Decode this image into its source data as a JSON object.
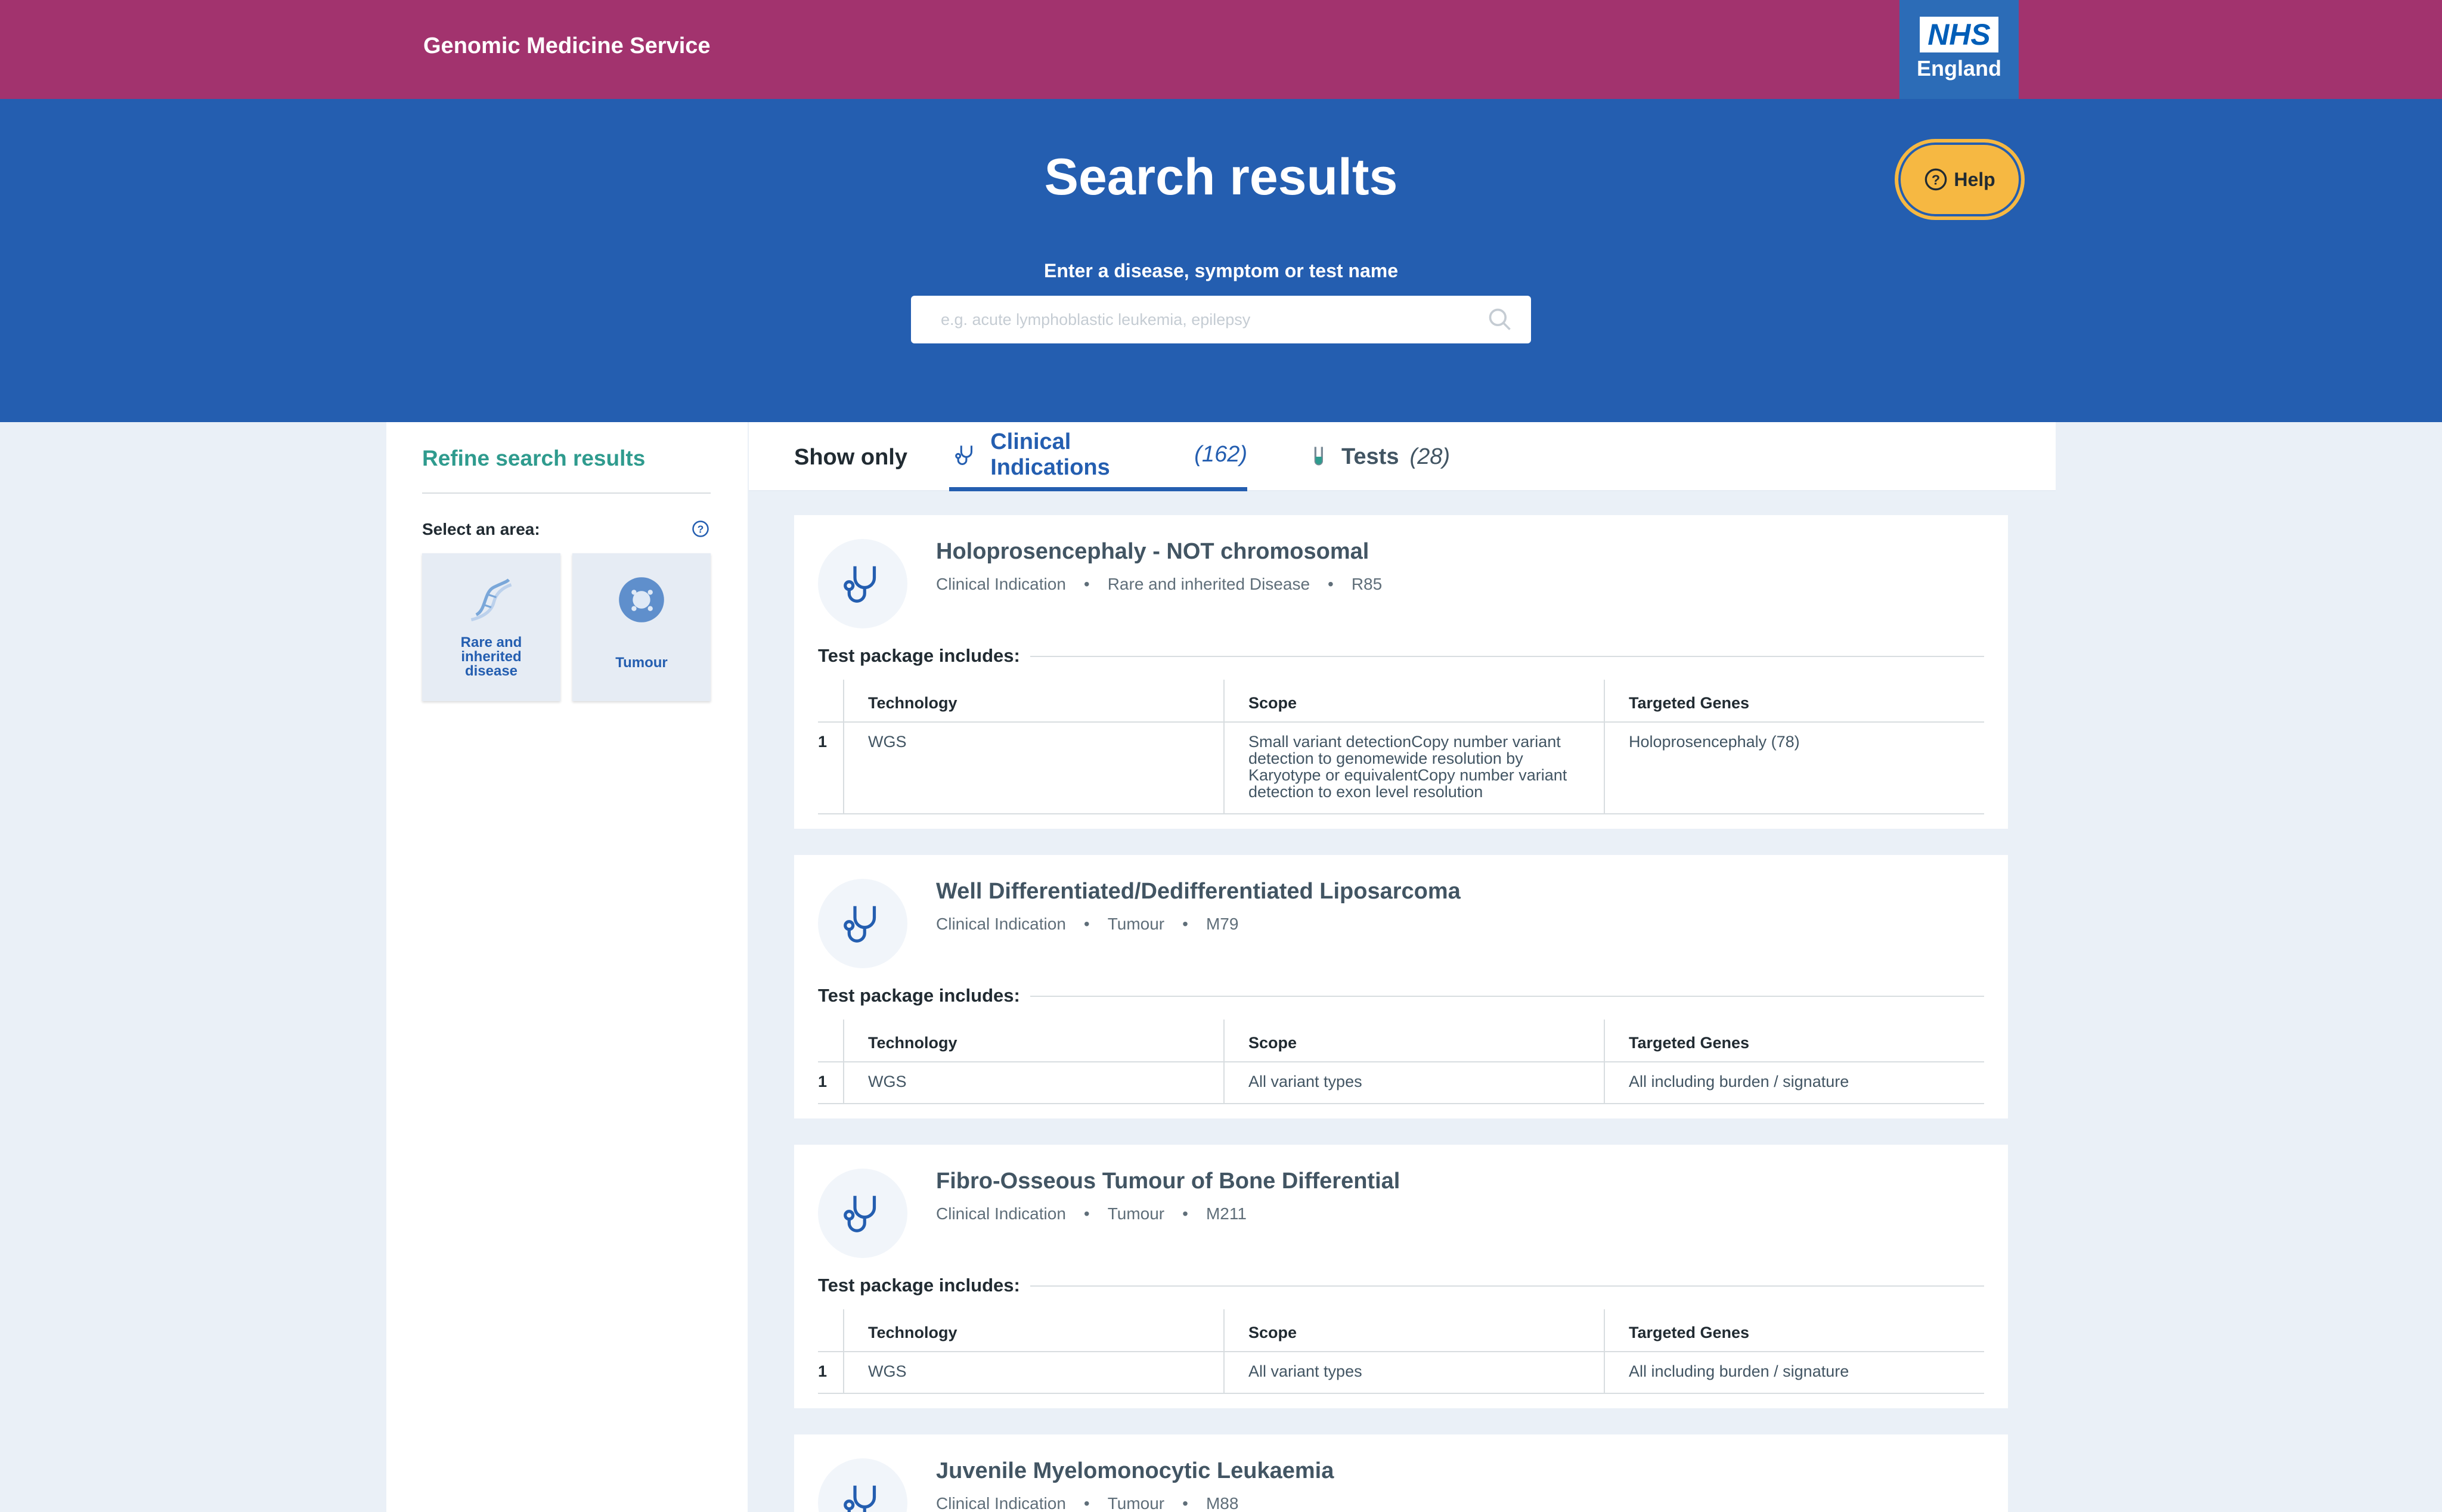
{
  "header": {
    "brand": "Genomic Medicine Service",
    "logo_mark": "NHS",
    "logo_sub": "England"
  },
  "hero": {
    "title": "Search results",
    "search_label": "Enter a disease, symptom or test name",
    "search_placeholder": "e.g. acute lymphoblastic leukemia, epilepsy",
    "help_label": "Help"
  },
  "sidebar": {
    "title": "Refine search results",
    "area_label": "Select an area:",
    "areas": [
      {
        "label": "Rare and inherited disease",
        "icon": "dna-icon"
      },
      {
        "label": "Tumour",
        "icon": "tumour-cell-icon"
      }
    ]
  },
  "tabs": {
    "show_only": "Show only",
    "items": [
      {
        "label": "Clinical Indications",
        "count": "(162)",
        "icon": "stethoscope-icon",
        "active": true
      },
      {
        "label": "Tests",
        "count": "(28)",
        "icon": "test-tube-icon",
        "active": false
      }
    ]
  },
  "results": [
    {
      "title": "Holoprosencephaly - NOT chromosomal",
      "type": "Clinical Indication",
      "area": "Rare and inherited Disease",
      "code": "R85",
      "package_label": "Test package includes:",
      "headers": [
        "Technology",
        "Scope",
        "Targeted Genes"
      ],
      "rows": [
        {
          "num": "1",
          "technology": "WGS",
          "scope": "Small variant detectionCopy number variant detection to genomewide resolution by Karyotype or equivalentCopy number variant detection to exon level resolution",
          "genes": "Holoprosencephaly (78)"
        }
      ]
    },
    {
      "title": "Well Differentiated/Dedifferentiated Liposarcoma",
      "type": "Clinical Indication",
      "area": "Tumour",
      "code": "M79",
      "package_label": "Test package includes:",
      "headers": [
        "Technology",
        "Scope",
        "Targeted Genes"
      ],
      "rows": [
        {
          "num": "1",
          "technology": "WGS",
          "scope": "All variant types",
          "genes": "All including burden / signature"
        }
      ]
    },
    {
      "title": "Fibro-Osseous Tumour of Bone Differential",
      "type": "Clinical Indication",
      "area": "Tumour",
      "code": "M211",
      "package_label": "Test package includes:",
      "headers": [
        "Technology",
        "Scope",
        "Targeted Genes"
      ],
      "rows": [
        {
          "num": "1",
          "technology": "WGS",
          "scope": "All variant types",
          "genes": "All including burden / signature"
        }
      ]
    },
    {
      "title": "Juvenile Myelomonocytic Leukaemia",
      "type": "Clinical Indication",
      "area": "Tumour",
      "code": "M88"
    }
  ],
  "colors": {
    "topbar": "#a2336e",
    "hero": "#245eb0",
    "accent_teal": "#2f9b8e",
    "help_yellow": "#f6b842"
  }
}
